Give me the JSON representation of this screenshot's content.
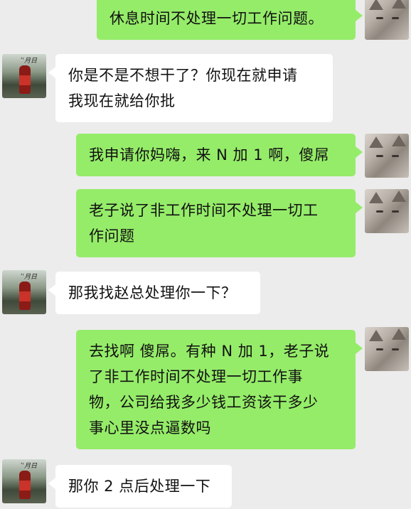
{
  "messages": [
    {
      "sender": "me",
      "text": "休息时间不处理一切工作问题。"
    },
    {
      "sender": "them",
      "text": "你是不是不想干了？你现在就申请\n我现在就给你批"
    },
    {
      "sender": "me",
      "text": "我申请你妈嗨，来 N 加 1 啊，傻屌"
    },
    {
      "sender": "me",
      "text": "老子说了非工作时间不处理一切工\n作问题"
    },
    {
      "sender": "them",
      "text": "那我找赵总处理你一下？"
    },
    {
      "sender": "me",
      "text": "去找啊 傻屌。有种 N 加 1，老子说\n了非工作时间不处理一切工作事\n物，公司给我多少钱工资该干多少\n事心里没点逼数吗"
    },
    {
      "sender": "them",
      "text": "那你 2 点后处理一下"
    }
  ],
  "colors": {
    "background": "#ececec",
    "my_bubble": "#95ec69",
    "their_bubble": "#ffffff"
  },
  "icons": {
    "my_avatar": "cat-avatar-icon",
    "their_avatar": "bottle-avatar-icon"
  }
}
